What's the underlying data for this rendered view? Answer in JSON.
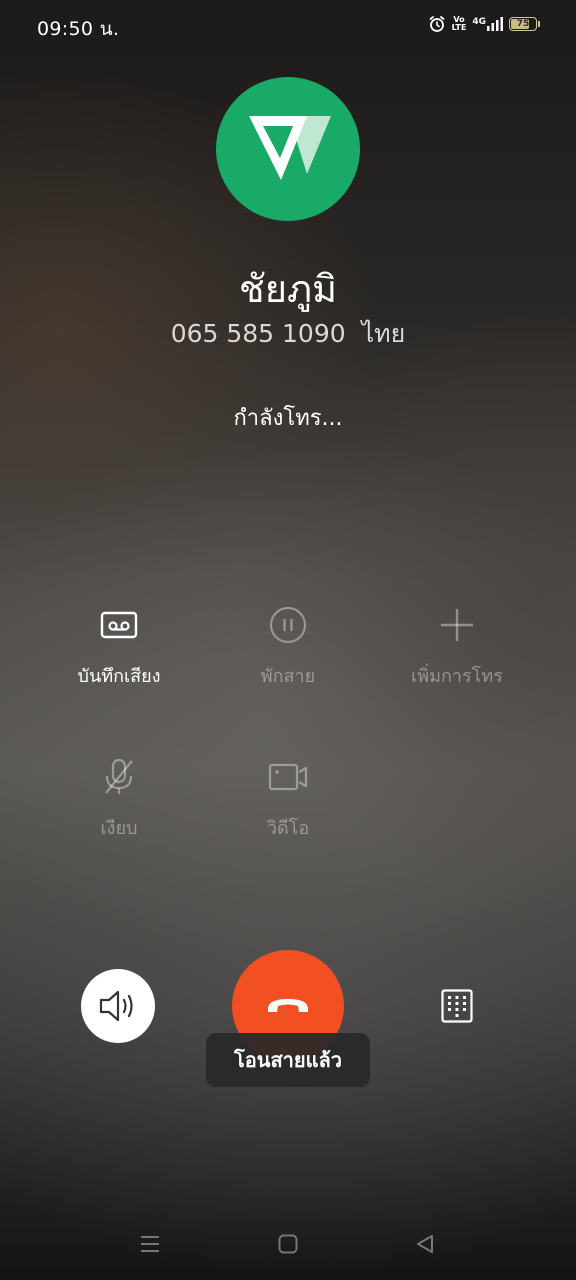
{
  "status_bar": {
    "time": "09:50 น.",
    "network": "4G",
    "volte": "Vo LTE",
    "battery": "75",
    "battery_level": 0.75
  },
  "contact": {
    "avatar_icon": "app-logo-icon",
    "avatar_color": "#1aaa68",
    "name": "ชัยภูมิ",
    "number": "065 585 1090",
    "region": "ไทย"
  },
  "call_status": "กำลังโทร...",
  "actions": [
    {
      "label": "บันทึกเสียง",
      "icon": "record-tape-icon",
      "enabled": true
    },
    {
      "label": "พักสาย",
      "icon": "pause-icon",
      "enabled": false
    },
    {
      "label": "เพิ่มการโทร",
      "icon": "plus-icon",
      "enabled": false
    },
    {
      "label": "เงียบ",
      "icon": "mic-off-icon",
      "enabled": false
    },
    {
      "label": "วิดีโอ",
      "icon": "video-icon",
      "enabled": false
    }
  ],
  "bottom_controls": {
    "speaker_icon": "speaker-icon",
    "end_call_icon": "end-call-icon",
    "end_call_color": "#f25022",
    "keypad_icon": "keypad-icon"
  },
  "toast": "โอนสายแล้ว",
  "nav_bar": [
    "menu-icon",
    "home-icon",
    "back-icon"
  ]
}
